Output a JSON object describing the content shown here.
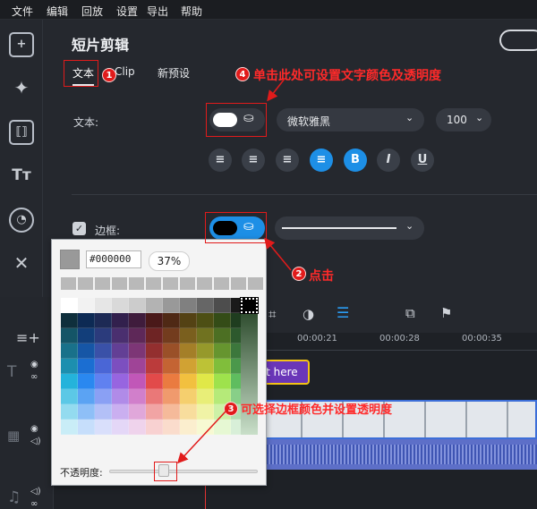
{
  "menubar": {
    "items": [
      "文件",
      "编辑",
      "回放",
      "设置",
      "导出",
      "帮助"
    ]
  },
  "panel": {
    "title": "短片剪辑",
    "tabs": [
      "文本",
      "Clip",
      "新预设"
    ],
    "text_label": "文本:",
    "font_name": "微软雅黑",
    "font_size": "100",
    "border_label": "边框:"
  },
  "annotations": {
    "n1": "1",
    "n2": "2",
    "n3": "3",
    "n4": "4",
    "note4": "单击此处可设置文字颜色及透明度",
    "note2": "点击",
    "note3": "可选择边框颜色并设置透明度"
  },
  "picker": {
    "hex": "#000000",
    "opacity": "37%",
    "opacity_label": "不透明度:",
    "opacity_value": 0.37,
    "palette": [
      [
        "#ffffff",
        "#f2f2f2",
        "#e6e6e6",
        "#d9d9d9",
        "#cccccc",
        "#b3b3b3",
        "#999999",
        "#808080",
        "#666666",
        "#4d4d4d",
        "#1a1a1a"
      ],
      [
        "#0f2f3c",
        "#0d2a54",
        "#1d2a55",
        "#32204d",
        "#3f1c3c",
        "#4a1919",
        "#4f2915",
        "#544214",
        "#4d4f14",
        "#344c17",
        "#1f3d1f"
      ],
      [
        "#145567",
        "#123e7a",
        "#2b3b7c",
        "#4a2f6f",
        "#5e2858",
        "#6e2424",
        "#733c1e",
        "#7a5f1e",
        "#707220",
        "#4c6f23",
        "#2d592d"
      ],
      [
        "#19718a",
        "#1656a6",
        "#3a51a8",
        "#633f95",
        "#7d3676",
        "#932f2f",
        "#9a5028",
        "#a47f28",
        "#96992b",
        "#66952f",
        "#3c773c"
      ],
      [
        "#1c8faf",
        "#1b6ed2",
        "#4a66d6",
        "#7c4fbf",
        "#9f4497",
        "#bb3b3b",
        "#c46433",
        "#d1a233",
        "#bdc236",
        "#80be3b",
        "#4b984b"
      ],
      [
        "#24b3db",
        "#2a88f0",
        "#6081f0",
        "#9765e0",
        "#c157b8",
        "#e24a4a",
        "#ea7b40",
        "#f2c03f",
        "#e0e848",
        "#9ee24c",
        "#5fbd5f"
      ],
      [
        "#5cc8e6",
        "#5ba3f3",
        "#8aa0f4",
        "#b08be8",
        "#d17fcb",
        "#ea7878",
        "#f09a6d",
        "#f5cf6e",
        "#e8ee78",
        "#b5ea79",
        "#88cf88"
      ],
      [
        "#93dbef",
        "#8ebff7",
        "#b3c0f7",
        "#caaff0",
        "#e0a7da",
        "#f1a4a4",
        "#f5ba9a",
        "#f8dd9d",
        "#f0f3a6",
        "#cdf1a7",
        "#b1dfb1"
      ],
      [
        "#c9edf7",
        "#c6defb",
        "#d9dffb",
        "#e4d7f7",
        "#efd3ec",
        "#f8d1d1",
        "#fadccc",
        "#fbeece",
        "#f7f9d2",
        "#e6f8d3",
        "#d8efd8"
      ]
    ]
  },
  "timeline": {
    "ticks": [
      "00:00:21",
      "00:00:28",
      "00:00:35"
    ],
    "text_clip": "xt here"
  }
}
